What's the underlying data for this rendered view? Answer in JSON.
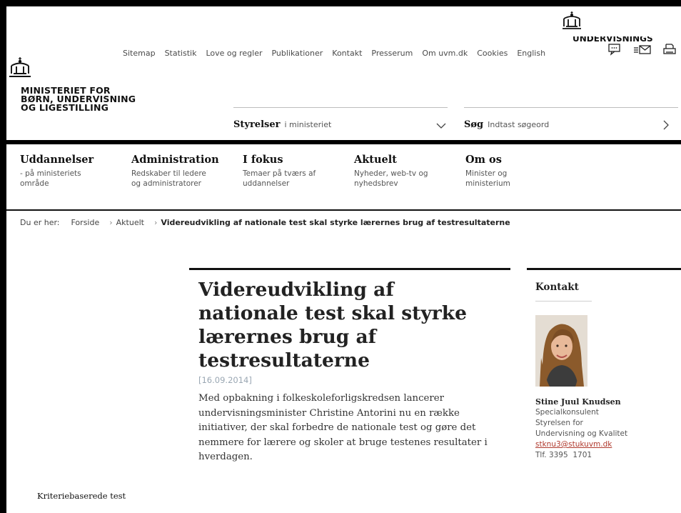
{
  "utility_nav": [
    "Sitemap",
    "Statistik",
    "Love og regler",
    "Publikationer",
    "Kontakt",
    "Presserum",
    "Om uvm.dk",
    "Cookies",
    "English"
  ],
  "icons": [
    "chat-icon",
    "newsletter-icon",
    "print-icon",
    "crown-logo-icon"
  ],
  "logo": {
    "line1": "MINISTERIET FOR",
    "line2": "BØRN, UNDERVISNING",
    "line3": "OG LIGESTILLING",
    "right_partial": "UNDERVISNINGS"
  },
  "styrelser": {
    "title": "Styrelser",
    "sub": "i ministeriet"
  },
  "search": {
    "title": "Søg",
    "placeholder": "Indtast søgeord"
  },
  "main_nav": [
    {
      "title": "Uddannelser",
      "sub1": "- på ministeriets",
      "sub2": "område"
    },
    {
      "title": "Administration",
      "sub1": "Redskaber til ledere",
      "sub2": "og administratorer"
    },
    {
      "title": "I fokus",
      "sub1": "Temaer på tværs af",
      "sub2": "uddannelser"
    },
    {
      "title": "Aktuelt",
      "sub1": "Nyheder, web-tv og",
      "sub2": "nyhedsbrev"
    },
    {
      "title": "Om os",
      "sub1": "Minister og",
      "sub2": "ministerium"
    }
  ],
  "breadcrumb": {
    "label": "Du er her:",
    "items": [
      "Forside",
      "Aktuelt"
    ],
    "current": "Videreudvikling af nationale test skal styrke lærernes brug af testresultaterne"
  },
  "article": {
    "title_lines": [
      "Videreudvikling af",
      "nationale test skal styrke",
      "lærernes brug af",
      "testresultaterne"
    ],
    "date": "[16.09.2014]",
    "lead_lines": [
      "Med opbakning i folkeskoleforligskredsen lancerer",
      "undervisningsminister Christine Antorini nu en række",
      "initiativer, der skal forbedre de nationale test og gøre det",
      "nemmere for lærere og skoler at bruge testenes resultater i",
      "hverdagen."
    ]
  },
  "contact": {
    "heading": "Kontakt",
    "name": "Stine Juul Knudsen",
    "role": "Specialkonsulent",
    "org1": "Styrelsen for",
    "org2": "Undervisning og Kvalitet",
    "email": "stknu3@stukuvm.dk",
    "phone": "Tlf. 3395  1701"
  },
  "footer_note": "Kriteriebaserede test"
}
